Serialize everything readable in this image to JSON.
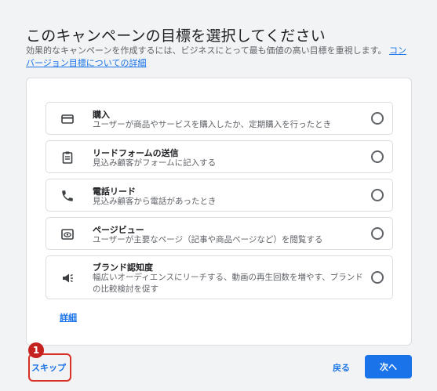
{
  "header": {
    "title": "このキャンペーンの目標を選択してください",
    "description": "効果的なキャンペーンを作成するには、ビジネスにとって最も価値の高い目標を重視します。",
    "link_text": "コンバージョン目標についての詳細"
  },
  "goals": [
    {
      "icon": "credit-card-icon",
      "title": "購入",
      "subtitle": "ユーザーが商品やサービスを購入したか、定期購入を行ったとき"
    },
    {
      "icon": "clipboard-icon",
      "title": "リードフォームの送信",
      "subtitle": "見込み顧客がフォームに記入する"
    },
    {
      "icon": "phone-icon",
      "title": "電話リード",
      "subtitle": "見込み顧客から電話があったとき"
    },
    {
      "icon": "eye-page-icon",
      "title": "ページビュー",
      "subtitle": "ユーザーが主要なページ（記事や商品ページなど）を閲覧する"
    },
    {
      "icon": "megaphone-icon",
      "title": "ブランド認知度",
      "subtitle": "幅広いオーディエンスにリーチする、動画の再生回数を増やす、ブランドの比較検討を促す"
    }
  ],
  "detail_link": "詳細",
  "annotation": {
    "badge": "1"
  },
  "footer": {
    "skip_label": "スキップ",
    "back_label": "戻る",
    "next_label": "次へ"
  },
  "colors": {
    "accent": "#1a73e8",
    "highlight": "#d93025"
  }
}
